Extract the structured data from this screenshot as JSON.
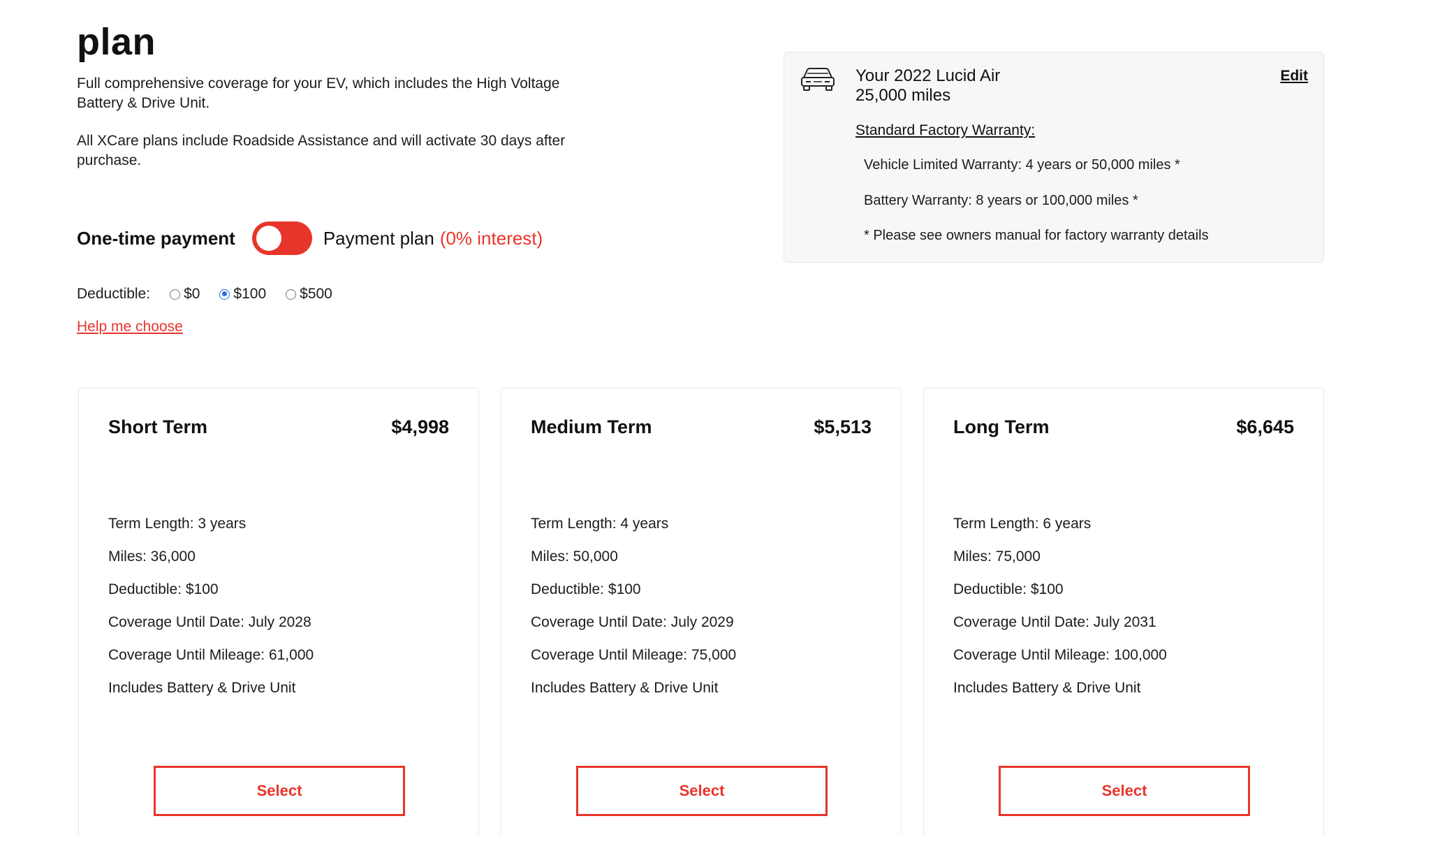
{
  "page": {
    "title": "plan",
    "intro_1": "Full comprehensive coverage for your EV, which includes the High Voltage Battery & Drive Unit.",
    "intro_2": "All XCare plans include Roadside Assistance and will activate 30 days after purchase."
  },
  "payment": {
    "one_time_label": "One-time payment",
    "plan_label": "Payment plan",
    "interest_label": "(0% interest)",
    "toggle_state": "payment-plan",
    "accent_color": "#e8352b"
  },
  "deductible": {
    "label": "Deductible:",
    "options": [
      "$0",
      "$100",
      "$500"
    ],
    "selected": "$100",
    "help_link": "Help me choose"
  },
  "vehicle": {
    "icon": "car-icon",
    "name": "Your 2022 Lucid Air",
    "miles": "25,000 miles",
    "edit_label": "Edit",
    "warranty_title": "Standard Factory Warranty:",
    "warranty_lines": [
      "Vehicle Limited Warranty: 4 years or 50,000 miles *",
      "Battery Warranty: 8 years or 100,000 miles *",
      "* Please see owners manual for factory warranty details"
    ]
  },
  "plans": [
    {
      "name": "Short Term",
      "price": "$4,998",
      "details": [
        "Term Length: 3 years",
        "Miles: 36,000",
        "Deductible: $100",
        "Coverage Until Date: July 2028",
        "Coverage Until Mileage: 61,000",
        "Includes Battery & Drive Unit"
      ],
      "button": "Select"
    },
    {
      "name": "Medium Term",
      "price": "$5,513",
      "details": [
        "Term Length: 4 years",
        "Miles: 50,000",
        "Deductible: $100",
        "Coverage Until Date: July 2029",
        "Coverage Until Mileage: 75,000",
        "Includes Battery & Drive Unit"
      ],
      "button": "Select"
    },
    {
      "name": "Long Term",
      "price": "$6,645",
      "details": [
        "Term Length: 6 years",
        "Miles: 75,000",
        "Deductible: $100",
        "Coverage Until Date: July 2031",
        "Coverage Until Mileage: 100,000",
        "Includes Battery & Drive Unit"
      ],
      "button": "Select"
    }
  ]
}
